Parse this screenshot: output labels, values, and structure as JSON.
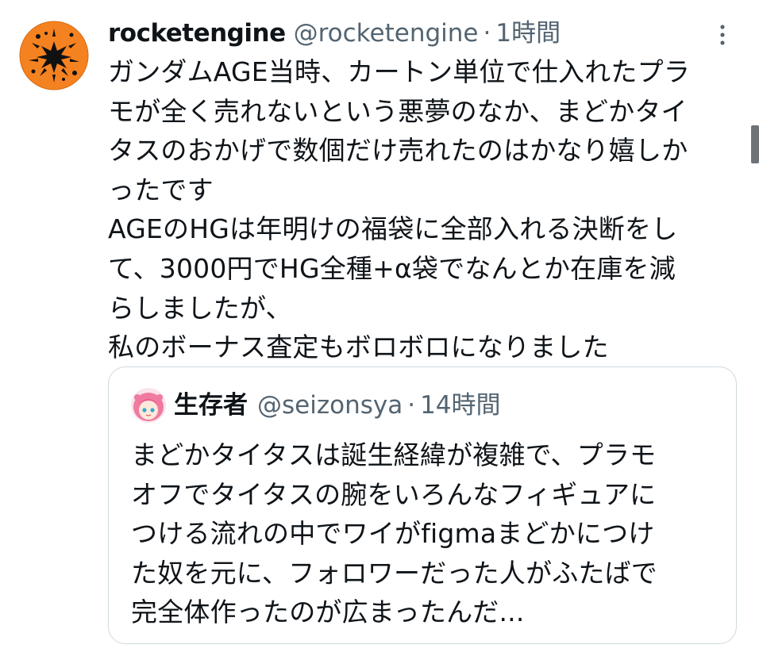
{
  "tweet": {
    "author": {
      "display_name": "rocketengine",
      "handle": "@rocketengine",
      "avatar": "explosion-hazard-icon"
    },
    "separator": "·",
    "time": "1時間",
    "more_icon": "more-vertical-icon",
    "text_lines": [
      "ガンダムAGE当時、カートン単位で仕入れたプラ",
      "モが全く売れないという悪夢のなか、まどかタイ",
      "タスのおかげで数個だけ売れたのはかなり嬉しか",
      "ったです",
      "AGEのHGは年明けの福袋に全部入れる決断をし",
      "て、3000円でHG全種+α袋でなんとか在庫を減",
      "らしましたが、",
      "私のボーナス査定もボロボロになりました"
    ]
  },
  "quoted_tweet": {
    "author": {
      "display_name": "生存者",
      "handle": "@seizonsya",
      "avatar": "pink-hair-character-avatar"
    },
    "separator": "·",
    "time": "14時間",
    "text_lines": [
      "まどかタイタスは誕生経緯が複雑で、プラモ",
      "オフでタイタスの腕をいろんなフィギュアに",
      "つける流れの中でワイがfigmaまどかにつけ",
      "た奴を元に、フォロワーだった人がふたばで",
      "完全体作ったのが広まったんだ..."
    ]
  },
  "colors": {
    "text_primary": "#0f1419",
    "text_secondary": "#536471",
    "border": "#cfd9de",
    "avatar_orange": "#f58220"
  }
}
